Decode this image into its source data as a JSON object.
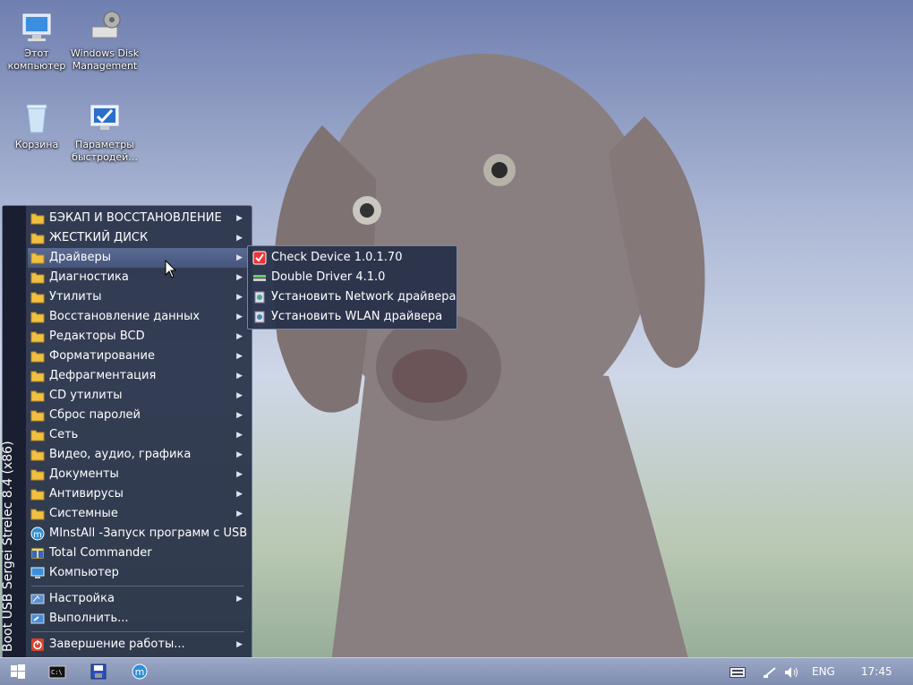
{
  "desktop": {
    "icons": [
      {
        "label_line1": "Этот",
        "label_line2": "компьютер",
        "icon": "computer-icon"
      },
      {
        "label_line1": "Windows Disk",
        "label_line2": "Management",
        "icon": "disk-management-icon"
      },
      {
        "label_line1": "Корзина",
        "label_line2": "",
        "icon": "recycle-bin-icon"
      },
      {
        "label_line1": "Параметры",
        "label_line2": "быстродей...",
        "icon": "performance-settings-icon"
      }
    ]
  },
  "start_menu": {
    "side_label": "Boot USB Sergei Strelec 8.4 (x86)",
    "items": [
      {
        "label": "БЭКАП И ВОССТАНОВЛЕНИЕ",
        "icon": "folder-icon",
        "submenu": true
      },
      {
        "label": "ЖЕСТКИЙ ДИСК",
        "icon": "folder-icon",
        "submenu": true
      },
      {
        "label": "Драйверы",
        "icon": "folder-icon",
        "submenu": true
      },
      {
        "label": "Диагностика",
        "icon": "folder-icon",
        "submenu": true
      },
      {
        "label": "Утилиты",
        "icon": "folder-icon",
        "submenu": true
      },
      {
        "label": "Восстановление данных",
        "icon": "folder-icon",
        "submenu": true
      },
      {
        "label": "Редакторы BCD",
        "icon": "folder-icon",
        "submenu": true
      },
      {
        "label": "Форматирование",
        "icon": "folder-icon",
        "submenu": true
      },
      {
        "label": "Дефрагментация",
        "icon": "folder-icon",
        "submenu": true
      },
      {
        "label": "CD утилиты",
        "icon": "folder-icon",
        "submenu": true
      },
      {
        "label": "Сброс паролей",
        "icon": "folder-icon",
        "submenu": true
      },
      {
        "label": "Сеть",
        "icon": "folder-icon",
        "submenu": true
      },
      {
        "label": "Видео, аудио, графика",
        "icon": "folder-icon",
        "submenu": true
      },
      {
        "label": "Документы",
        "icon": "folder-icon",
        "submenu": true
      },
      {
        "label": "Антивирусы",
        "icon": "folder-icon",
        "submenu": true
      },
      {
        "label": "Системные",
        "icon": "folder-icon",
        "submenu": true
      },
      {
        "label": "MInstAll -Запуск программ с USB",
        "icon": "minstall-icon",
        "submenu": false
      },
      {
        "label": "Total Commander",
        "icon": "total-commander-icon",
        "submenu": false
      },
      {
        "label": "Компьютер",
        "icon": "computer-icon",
        "submenu": false
      }
    ],
    "settings_label": "Настройка",
    "run_label": "Выполнить...",
    "shutdown_label": "Завершение работы..."
  },
  "drivers_submenu": {
    "items": [
      {
        "label": "Check Device 1.0.1.70",
        "icon": "check-device-icon"
      },
      {
        "label": "Double Driver 4.1.0",
        "icon": "double-driver-icon"
      },
      {
        "label": "Установить Network драйвера",
        "icon": "install-driver-icon"
      },
      {
        "label": "Установить WLAN драйвера",
        "icon": "install-driver-icon"
      }
    ]
  },
  "taskbar": {
    "buttons": [
      "start-icon",
      "cmd-icon",
      "save-icon",
      "minstall-icon"
    ],
    "tray": {
      "keyboard": "keyboard-icon",
      "network": "network-icon",
      "volume": "volume-icon"
    },
    "language": "ENG",
    "clock": "17:45"
  },
  "colors": {
    "menu_bg": "#263046",
    "highlight": "#5a6a92",
    "folder": "#f0c040"
  }
}
